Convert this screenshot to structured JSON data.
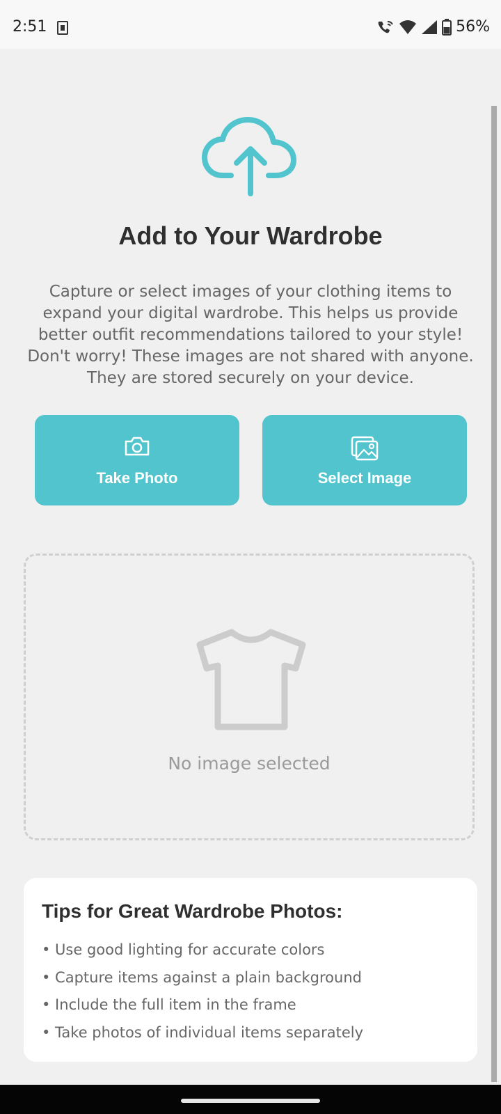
{
  "status_bar": {
    "time": "2:51",
    "battery": "56%"
  },
  "header": {
    "upload_icon": "cloud-upload-icon",
    "title": "Add to Your Wardrobe",
    "description": "Capture or select images of your clothing items to expand your digital wardrobe. This helps us provide better outfit recommendations tailored to your style! Don't worry! These images are not shared with anyone. They are stored securely on your device."
  },
  "actions": {
    "take_photo": {
      "label": "Take Photo",
      "icon": "camera-icon"
    },
    "select_image": {
      "label": "Select Image",
      "icon": "gallery-icon"
    }
  },
  "preview": {
    "icon": "tshirt-icon",
    "empty_text": "No image selected"
  },
  "tips": {
    "title": "Tips for Great Wardrobe Photos:",
    "items": [
      "• Use good lighting for accurate colors",
      "• Capture items against a plain background",
      "• Include the full item in the frame",
      "• Take photos of individual items separately"
    ]
  },
  "colors": {
    "accent": "#52c4cd",
    "background": "#f0f0f0",
    "title_text": "#2f2f2f",
    "body_text": "#666666",
    "placeholder_icon": "#cccccc"
  }
}
